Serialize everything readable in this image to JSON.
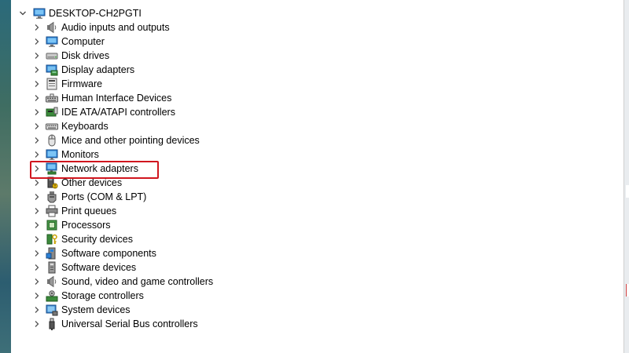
{
  "window": {
    "root_label": "DESKTOP-CH2PGTI"
  },
  "tree": {
    "items": [
      {
        "label": "Audio inputs and outputs",
        "icon": "speaker-icon"
      },
      {
        "label": "Computer",
        "icon": "computer-icon"
      },
      {
        "label": "Disk drives",
        "icon": "disk-drive-icon"
      },
      {
        "label": "Display adapters",
        "icon": "display-adapter-icon"
      },
      {
        "label": "Firmware",
        "icon": "firmware-icon"
      },
      {
        "label": "Human Interface Devices",
        "icon": "hid-icon"
      },
      {
        "label": "IDE ATA/ATAPI controllers",
        "icon": "ide-controller-icon"
      },
      {
        "label": "Keyboards",
        "icon": "keyboard-icon"
      },
      {
        "label": "Mice and other pointing devices",
        "icon": "mouse-icon"
      },
      {
        "label": "Monitors",
        "icon": "monitor-icon"
      },
      {
        "label": "Network adapters",
        "icon": "network-adapter-icon"
      },
      {
        "label": "Other devices",
        "icon": "other-device-icon"
      },
      {
        "label": "Ports (COM & LPT)",
        "icon": "port-icon"
      },
      {
        "label": "Print queues",
        "icon": "printer-icon"
      },
      {
        "label": "Processors",
        "icon": "processor-icon"
      },
      {
        "label": "Security devices",
        "icon": "security-key-icon"
      },
      {
        "label": "Software components",
        "icon": "software-component-icon"
      },
      {
        "label": "Software devices",
        "icon": "software-device-icon"
      },
      {
        "label": "Sound, video and game controllers",
        "icon": "sound-controller-icon"
      },
      {
        "label": "Storage controllers",
        "icon": "storage-controller-icon"
      },
      {
        "label": "System devices",
        "icon": "system-device-icon"
      },
      {
        "label": "Universal Serial Bus controllers",
        "icon": "usb-icon"
      }
    ]
  },
  "colors": {
    "highlight": "#d0161e"
  }
}
